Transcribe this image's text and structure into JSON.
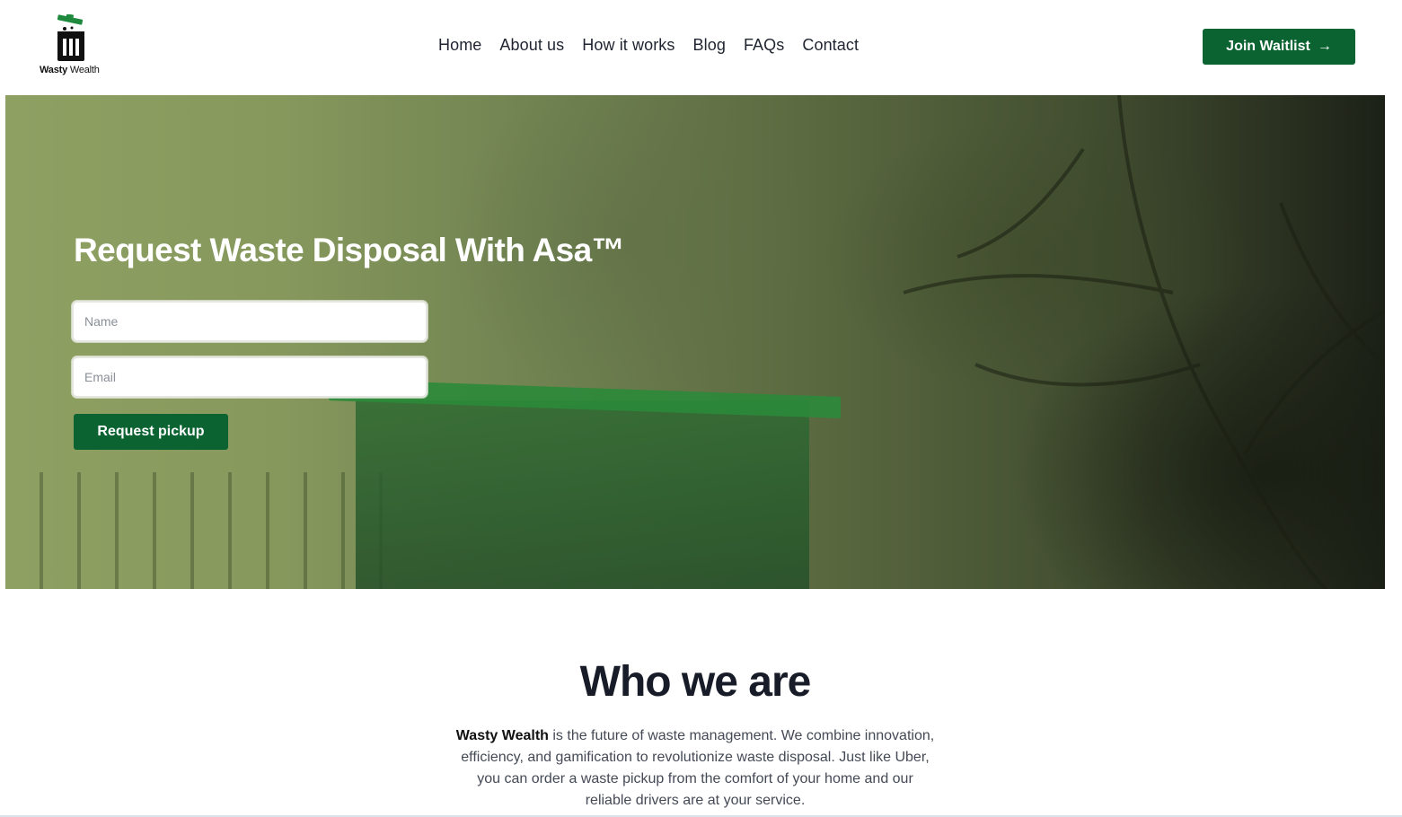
{
  "header": {
    "logo": {
      "name_bold": "Wasty",
      "name_rest": "Wealth",
      "icon": "trash-bin-icon"
    },
    "nav": [
      {
        "label": "Home"
      },
      {
        "label": "About us"
      },
      {
        "label": "How it works"
      },
      {
        "label": "Blog"
      },
      {
        "label": "FAQs"
      },
      {
        "label": "Contact"
      }
    ],
    "cta": {
      "label": "Join Waitlist",
      "icon": "arrow-right-icon",
      "arrow": "→"
    }
  },
  "hero": {
    "title": "Request Waste Disposal With Asa™",
    "name_placeholder": "Name",
    "email_placeholder": "Email",
    "submit_label": "Request pickup"
  },
  "who": {
    "title": "Who we are",
    "brand": "Wasty Wealth",
    "body": " is the future of waste management. We combine innovation, efficiency, and gamification to revolutionize waste disposal. Just like Uber, you can order a waste pickup from the comfort of your home and our reliable drivers are at your service."
  },
  "colors": {
    "brand_green": "#0b6331",
    "hero_tint": "#8ea062",
    "text_dark": "#171c28"
  }
}
